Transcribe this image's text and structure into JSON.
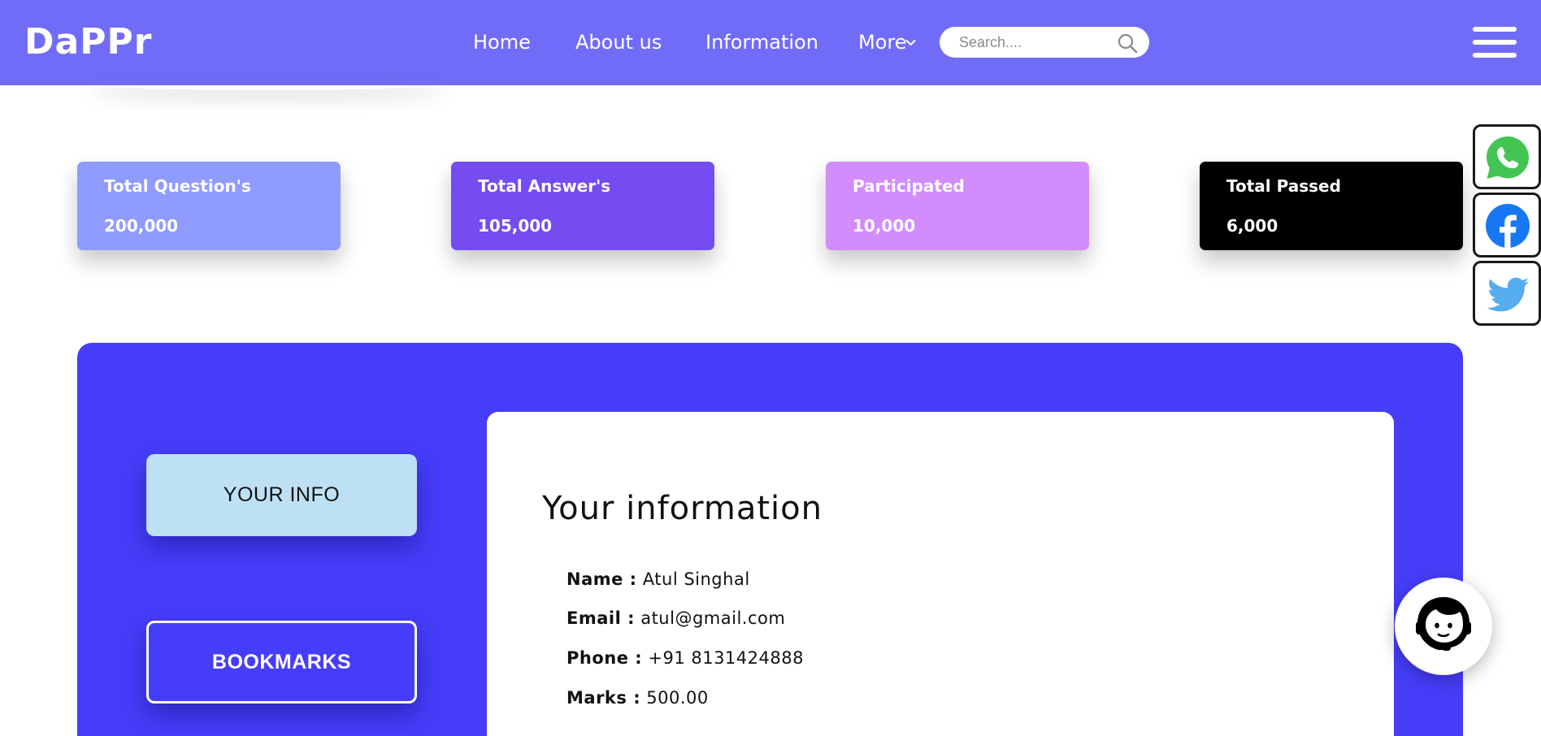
{
  "brand": {
    "logo_text": "DaPPr"
  },
  "nav": {
    "items": [
      {
        "label": "Home"
      },
      {
        "label": "About us"
      },
      {
        "label": "Information"
      },
      {
        "label": "More"
      }
    ]
  },
  "search": {
    "placeholder": "Search...."
  },
  "stats": [
    {
      "title": "Total Question's",
      "value": "200,000",
      "color": "#8f9bff"
    },
    {
      "title": "Total Answer's",
      "value": "105,000",
      "color": "#744cf1"
    },
    {
      "title": "Participated",
      "value": "10,000",
      "color": "#d38cfb"
    },
    {
      "title": "Total Passed",
      "value": "6,000",
      "color": "#000000"
    }
  ],
  "social": [
    {
      "icon": "whatsapp-icon",
      "color": "#43c553"
    },
    {
      "icon": "facebook-icon",
      "color": "#1877f2"
    },
    {
      "icon": "twitter-icon",
      "color": "#55acee"
    }
  ],
  "sidebar": {
    "your_info_label": "YOUR INFO",
    "bookmarks_label": "BOOKMARKS"
  },
  "info": {
    "title": "Your information",
    "rows": [
      {
        "key": "Name :",
        "value": "Atul Singhal"
      },
      {
        "key": "Email :",
        "value": "atul@gmail.com"
      },
      {
        "key": "Phone :",
        "value": "+91 8131424888"
      },
      {
        "key": "Marks :",
        "value": "500.00"
      }
    ]
  },
  "colors": {
    "header_bg": "#716cf8",
    "panel_bg": "#463df9",
    "your_info_bg": "#bde0f5"
  }
}
